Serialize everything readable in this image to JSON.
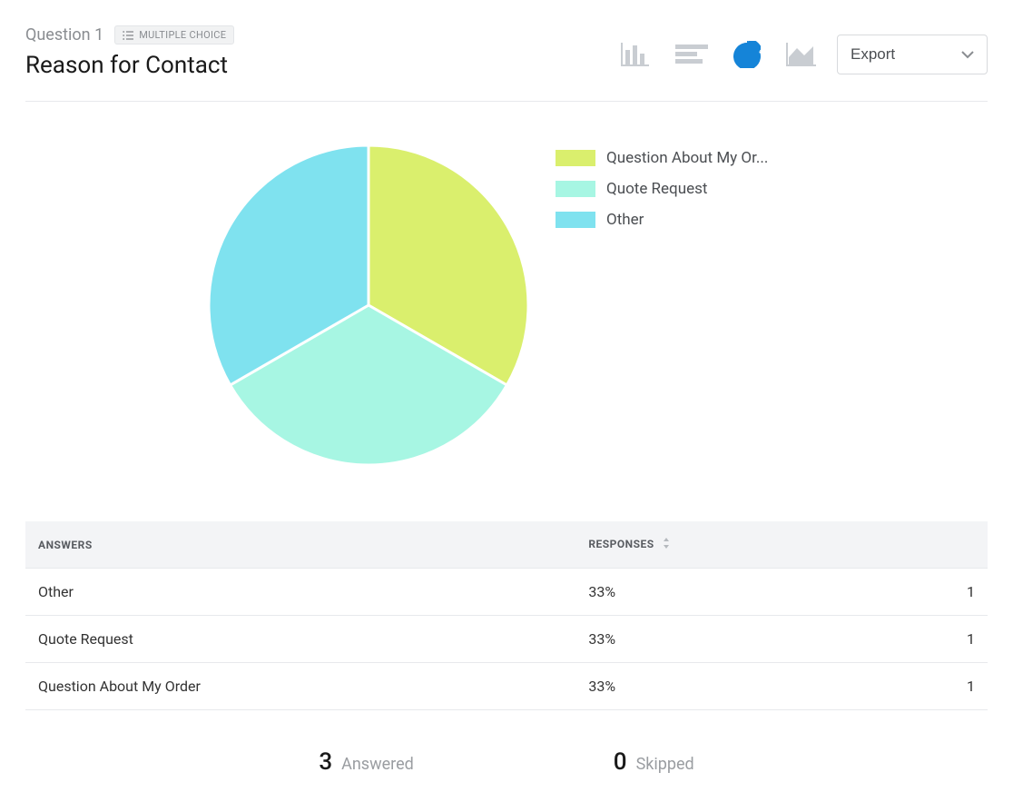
{
  "header": {
    "question_number": "Question 1",
    "question_type": "MULTIPLE CHOICE",
    "title": "Reason for Contact",
    "export_label": "Export"
  },
  "colors": {
    "icon_inactive": "#c9cdd2",
    "icon_active": "#1584d8",
    "slice1": "#daef6d",
    "slice2": "#a7f6e3",
    "slice3": "#7fe2ef"
  },
  "legend": [
    {
      "label": "Question About My Or...",
      "color": "#daef6d"
    },
    {
      "label": "Quote Request",
      "color": "#a7f6e3"
    },
    {
      "label": "Other",
      "color": "#7fe2ef"
    }
  ],
  "table": {
    "col_answers": "ANSWERS",
    "col_responses": "RESPONSES",
    "rows": [
      {
        "answer": "Other",
        "pct": "33%",
        "count": "1"
      },
      {
        "answer": "Quote Request",
        "pct": "33%",
        "count": "1"
      },
      {
        "answer": "Question About My Order",
        "pct": "33%",
        "count": "1"
      }
    ]
  },
  "summary": {
    "answered_count": "3",
    "answered_label": "Answered",
    "skipped_count": "0",
    "skipped_label": "Skipped"
  },
  "chart_data": {
    "type": "pie",
    "title": "Reason for Contact",
    "series": [
      {
        "name": "Question About My Order",
        "value": 1,
        "pct": 33,
        "color": "#daef6d"
      },
      {
        "name": "Quote Request",
        "value": 1,
        "pct": 33,
        "color": "#a7f6e3"
      },
      {
        "name": "Other",
        "value": 1,
        "pct": 33,
        "color": "#7fe2ef"
      }
    ],
    "total": 3
  }
}
